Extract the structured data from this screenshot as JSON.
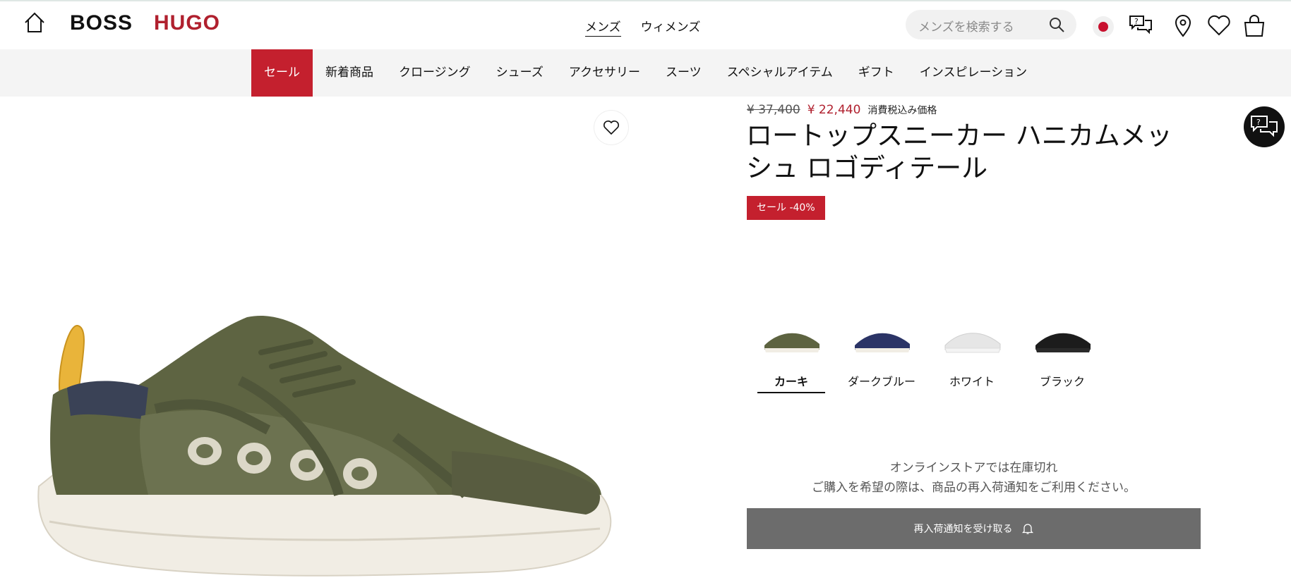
{
  "header": {
    "brand_boss": "BOSS",
    "brand_hugo": "HUGO",
    "gender_tabs": [
      "メンズ",
      "ウィメンズ"
    ],
    "search_placeholder": "メンズを検索する",
    "icons": [
      "home-icon",
      "search-icon",
      "japan-flag-icon",
      "help-chat-icon",
      "location-pin-icon",
      "heart-icon",
      "shopping-bag-icon"
    ]
  },
  "catnav": {
    "items": [
      "セール",
      "新着商品",
      "クロージング",
      "シューズ",
      "アクセサリー",
      "スーツ",
      "スペシャルアイテム",
      "ギフト",
      "インスピレーション"
    ]
  },
  "product": {
    "price_old": "¥ 37,400",
    "price_new": "¥ 22,440",
    "price_note": "消費税込み価格",
    "title": "ロートップスニーカー ハニカムメッシュ ロゴディテール",
    "badge": "セール -40%",
    "colors": [
      {
        "label": "カーキ",
        "color": "#5d6340"
      },
      {
        "label": "ダークブルー",
        "color": "#2b3466"
      },
      {
        "label": "ホワイト",
        "color": "#e6e6e6"
      },
      {
        "label": "ブラック",
        "color": "#1c1c1c"
      }
    ],
    "stock_line1": "オンラインストアでは在庫切れ",
    "stock_line2": "ご購入を希望の際は、商品の再入荷通知をご利用ください。",
    "notify_label": "再入荷通知を受け取る"
  },
  "colors": {
    "sale_red": "#c4202e",
    "hugo_red": "#b0202e",
    "button_gray": "#6c6c6c",
    "nav_bg": "#f4f4f4"
  }
}
